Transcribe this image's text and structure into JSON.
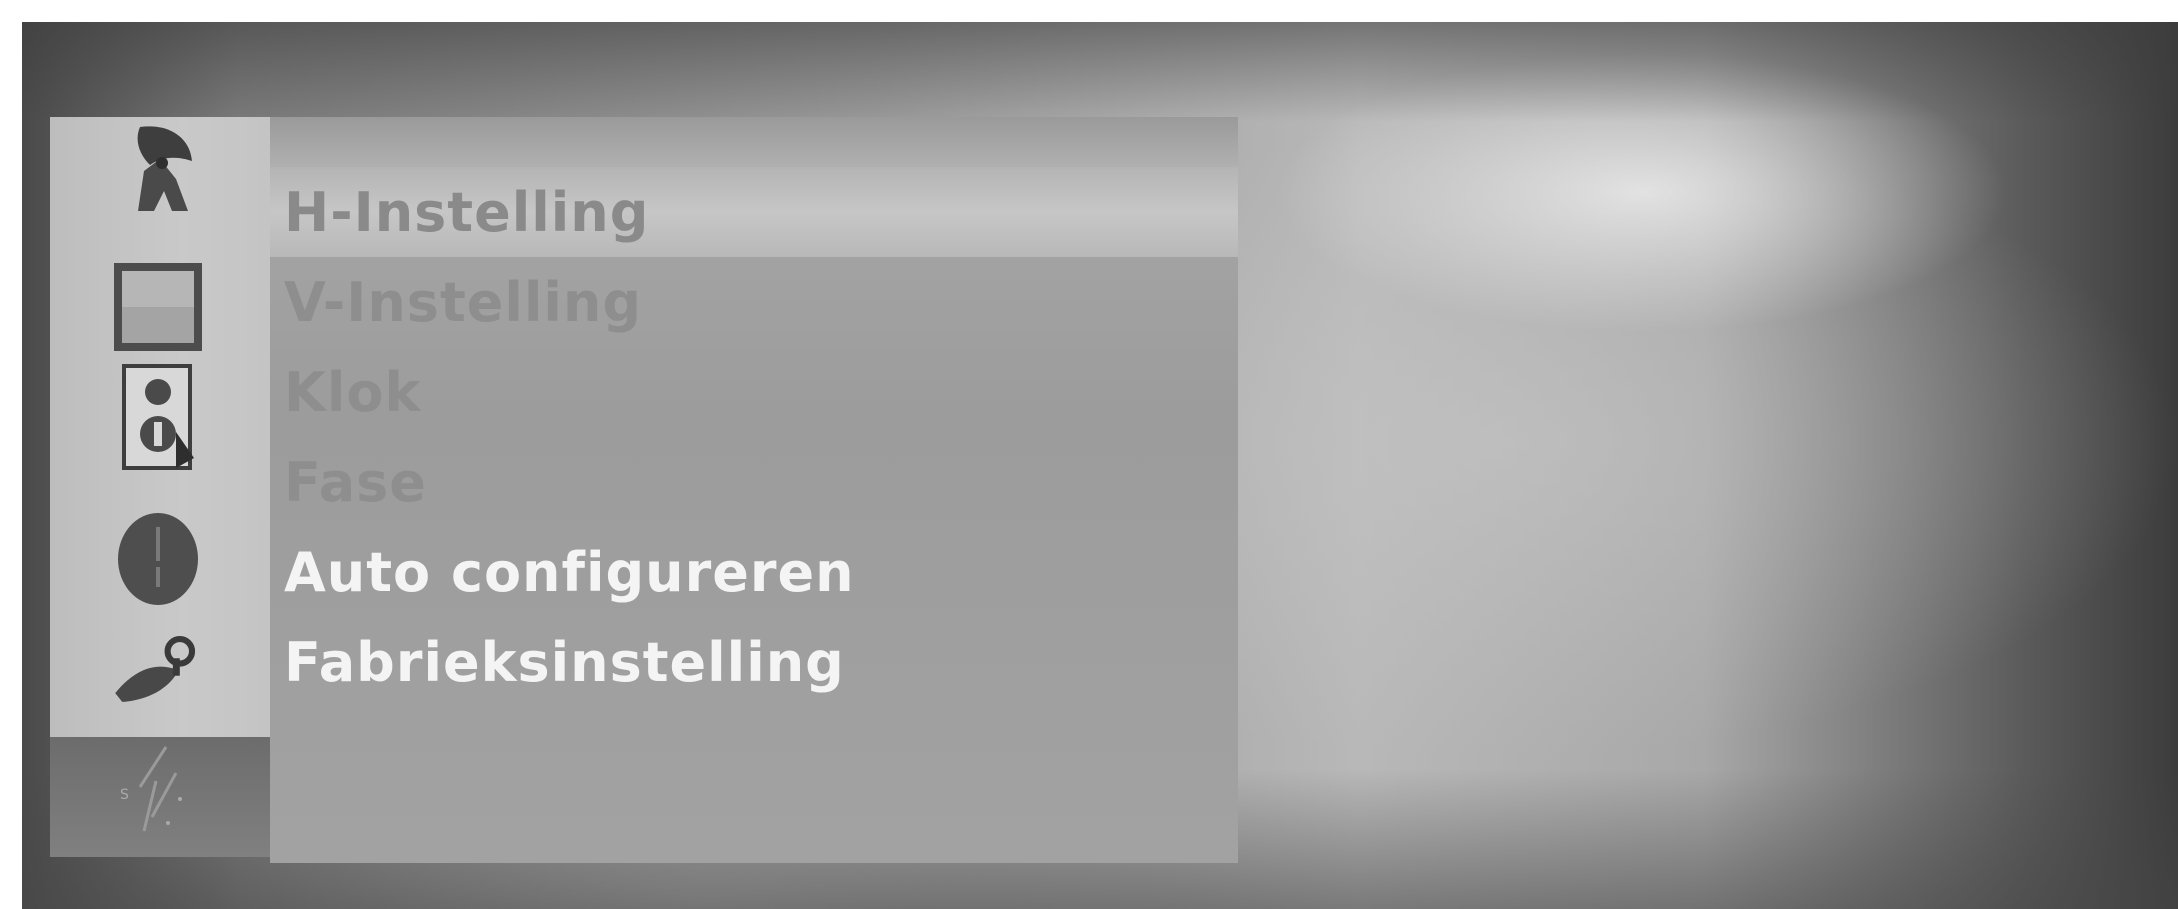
{
  "menu": {
    "items": [
      {
        "label": "H-Instelling",
        "state": "selected"
      },
      {
        "label": "V-Instelling",
        "state": "dim"
      },
      {
        "label": "Klok",
        "state": "dim"
      },
      {
        "label": "Fase",
        "state": "dim"
      },
      {
        "label": "Auto configureren",
        "state": "bright"
      },
      {
        "label": "Fabrieksinstelling",
        "state": "bright"
      }
    ]
  },
  "icons": [
    "satellite-dish-icon",
    "screen-icon",
    "speaker-icon",
    "clock-icon",
    "settings-key-icon",
    "special-icon"
  ],
  "colors": {
    "menu_panel": "#a2a2a2",
    "selected_row": "#c0c0c0",
    "text_dim": "#8e8e8e",
    "text_bright": "#f4f4f4"
  }
}
